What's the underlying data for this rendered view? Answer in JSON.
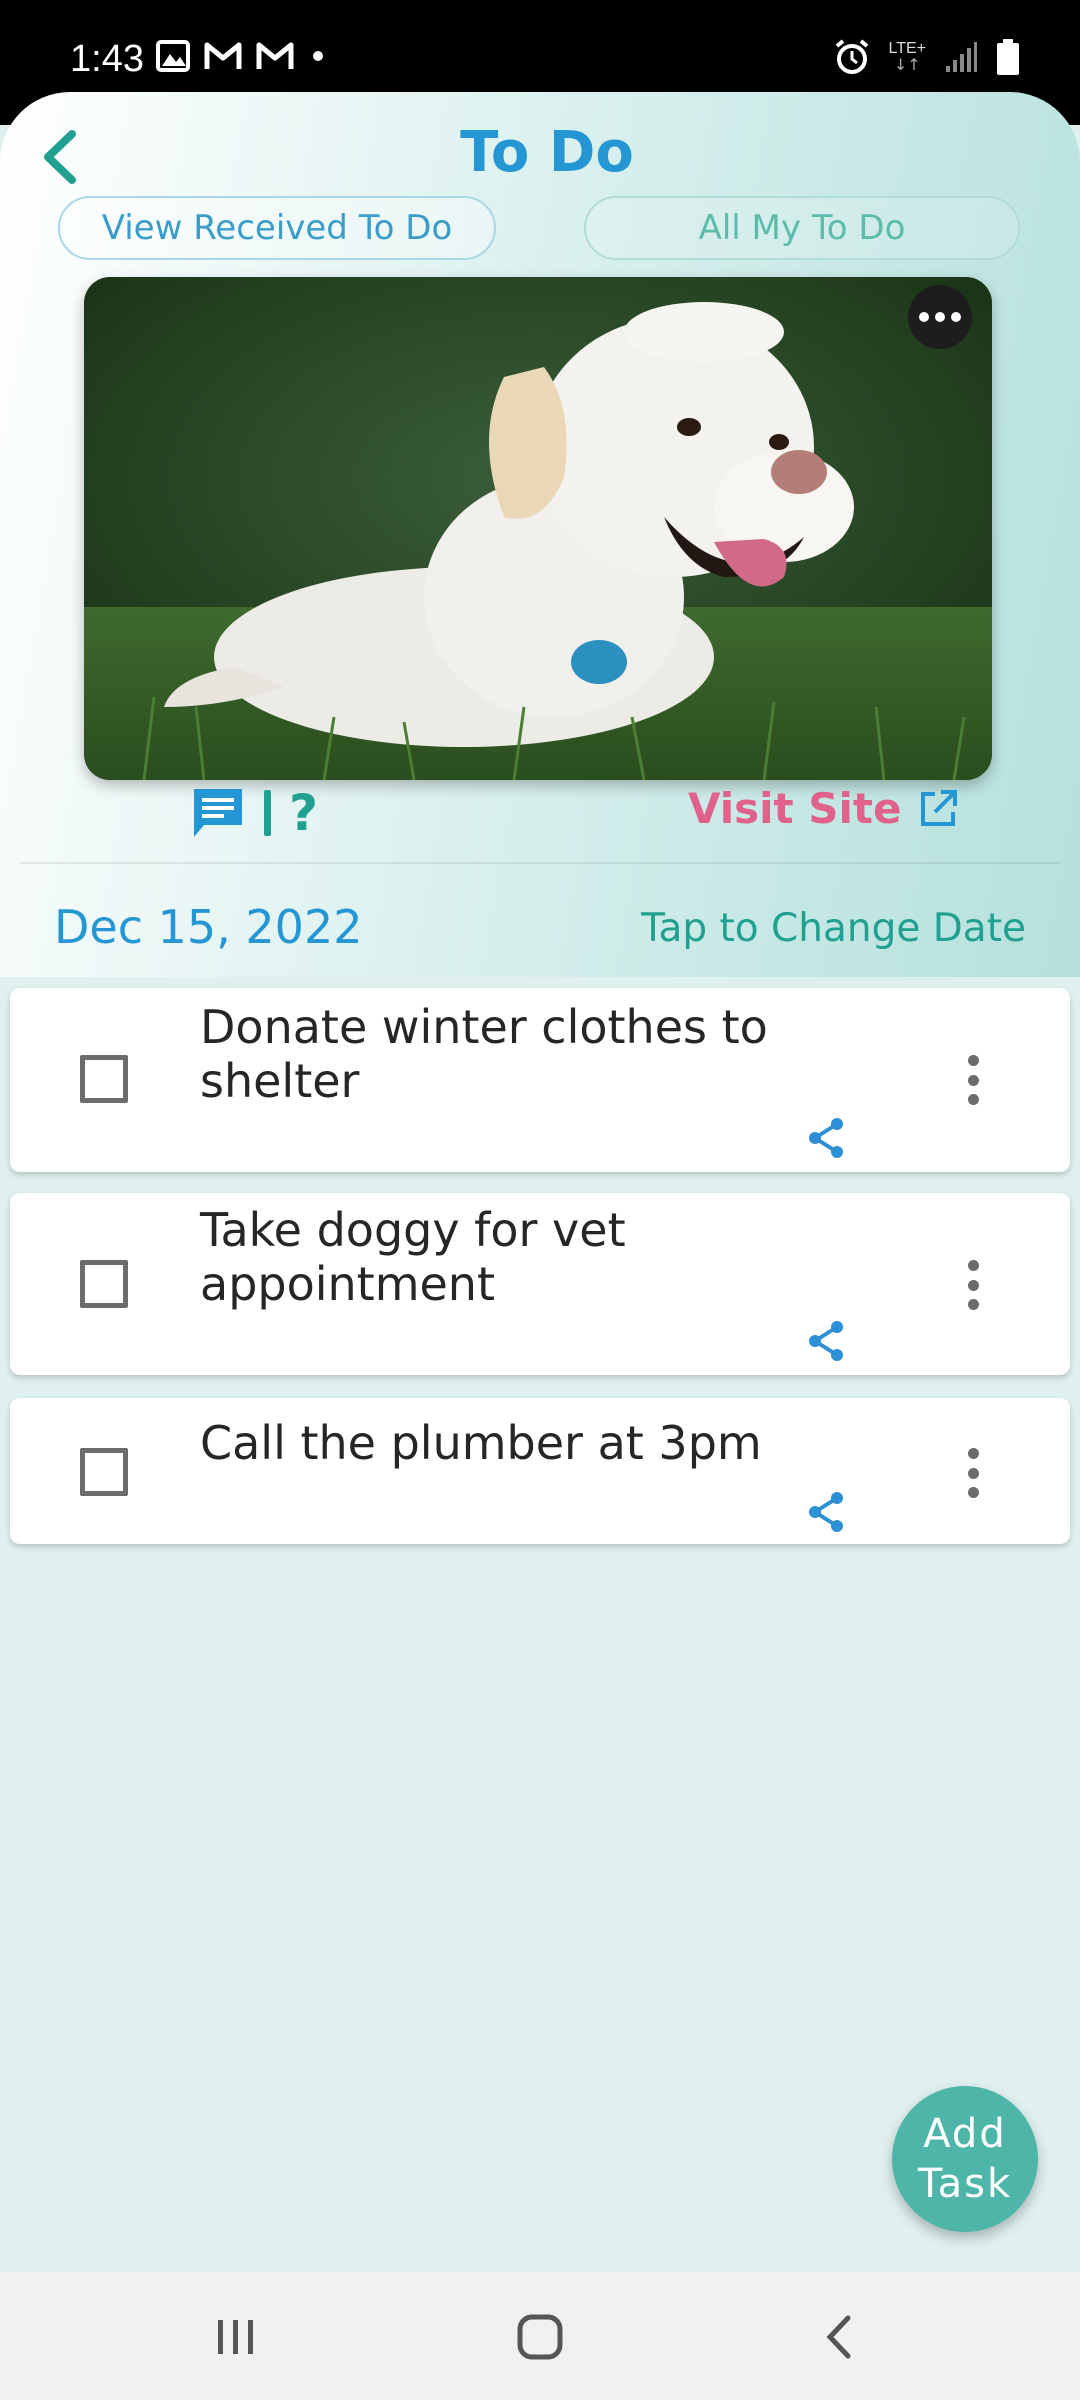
{
  "status_bar": {
    "time": "1:43",
    "left_icons": [
      "image-icon",
      "gmail-icon",
      "gmail-icon",
      "dot-icon"
    ],
    "network_label": "LTE+",
    "right_icons": [
      "alarm-icon",
      "lte-icon",
      "signal-icon",
      "battery-icon"
    ]
  },
  "header": {
    "title": "To Do",
    "back_icon": "chevron-left-icon"
  },
  "tabs": {
    "received_label": "View Received To Do",
    "all_label": "All My To Do"
  },
  "hero": {
    "image_desc_icon": "dog-photo",
    "more_icon": "more-horizontal-icon"
  },
  "actions": {
    "chat_icon": "chat-icon",
    "help_label": "?",
    "visit_site_label": "Visit Site",
    "visit_site_icon": "external-link-icon"
  },
  "date": {
    "value": "Dec 15, 2022",
    "change_label": "Tap to Change Date"
  },
  "tasks": [
    {
      "text": "Donate winter clothes to shelter",
      "checked": false
    },
    {
      "text": "Take doggy for vet appointment",
      "checked": false
    },
    {
      "text": "Call the plumber at 3pm",
      "checked": false
    }
  ],
  "fab": {
    "label_line1": "Add",
    "label_line2": "Task"
  },
  "colors": {
    "title_blue": "#2596d4",
    "teal": "#20a090",
    "pink": "#e0628a",
    "fab_teal": "#4db6a8",
    "share_blue": "#2d8fd6"
  },
  "nav_bar": [
    "recents-icon",
    "home-icon",
    "back-icon"
  ]
}
